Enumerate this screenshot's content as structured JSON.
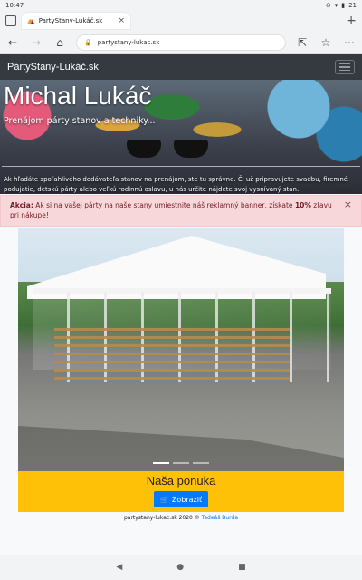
{
  "status": {
    "time": "10:47",
    "battery": "21"
  },
  "browser": {
    "tab_title": "PartyStany-Lukáč.sk",
    "tab_close": "×",
    "new_tab": "+",
    "url": "partystany-lukac.sk",
    "icons": [
      "tabs-icon",
      "back-icon",
      "forward-icon",
      "home-icon",
      "lock-icon",
      "open-in-new-icon",
      "favorites-icon",
      "menu-icon"
    ]
  },
  "navbar": {
    "brand": "PártyStany-Lukáč.sk"
  },
  "hero": {
    "title": "Michal Lukáč",
    "subtitle": "Prenájom párty stanov a techniky...",
    "text": "Ak hľadáte spoľahlivého dodávateľa stanov na prenájom, ste tu správne. Či už pripravujete svadbu, firemné podujatie, detskú párty alebo veľkú rodinnú oslavu, u nás určite nájdete svoj vysnívaný stan."
  },
  "alert": {
    "label": "Akcia:",
    "text_before": " Ak si na vašej párty na naše stany umiestnite náš reklamný banner, získate ",
    "highlight": "10%",
    "text_after": " zľavu pri nákupe!",
    "close": "×"
  },
  "offer": {
    "title": "Naša ponuka",
    "button": "Zobraziť"
  },
  "footer": {
    "text": "partystany-lukac.sk 2020 © ",
    "author": "Tadeáš Burda"
  },
  "sysnav": {
    "back": "◀",
    "home": "●",
    "recents": "■"
  }
}
